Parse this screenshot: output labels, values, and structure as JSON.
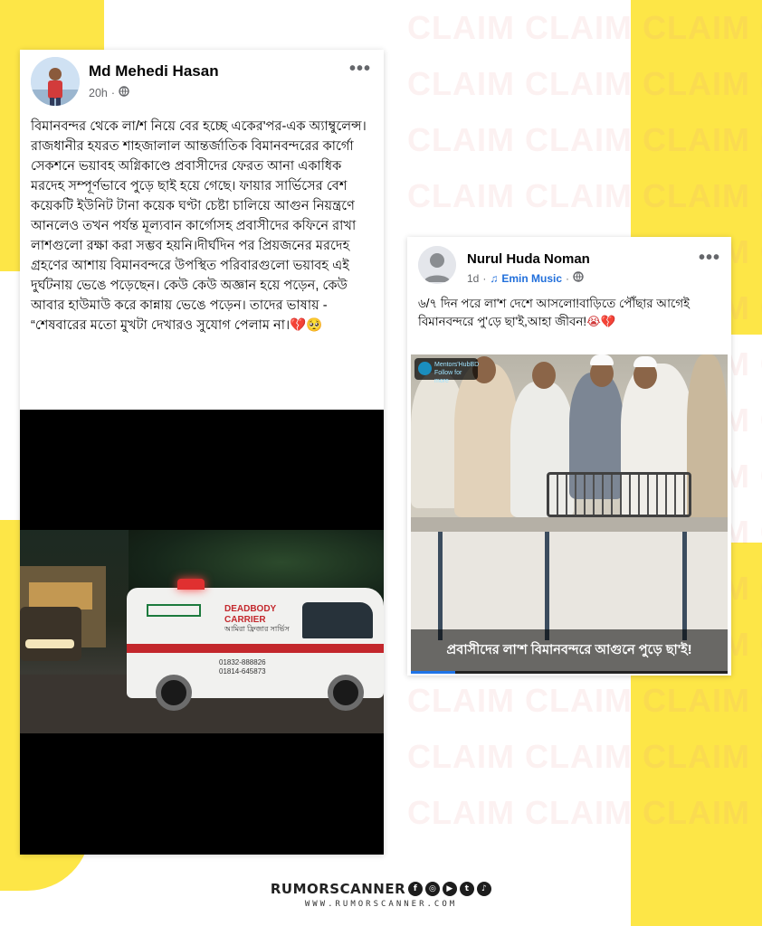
{
  "watermark": {
    "rows": [
      "CLAIM CLAIM CLAIM CLAIM",
      "CLAIM CLAIM CLAIM CLAIM",
      "CLAIM CLAIM CLAIM CLAIM",
      "CLAIM CLAIM CLAIM CLAIM",
      "CLAIM CLAIM CLAIM CLAIM",
      "CLAIM CLAIM CLAIM CLAIM",
      "CLAIM CLAIM CLAIM CLAIM",
      "CLAIM CLAIM CLAIM CLAIM",
      "CLAIM CLAIM CLAIM CLAIM",
      "CLAIM CLAIM CLAIM CLAIM",
      "CLAIM CLAIM CLAIM CLAIM",
      "CLAIM CLAIM CLAIM CLAIM",
      "CLAIM CLAIM CLAIM CLAIM",
      "CLAIM CLAIM CLAIM CLAIM",
      "CLAIM CLAIM CLAIM CLAIM"
    ]
  },
  "post1": {
    "author": "Md Mehedi Hasan",
    "time": "20h",
    "separator": "·",
    "privacy_icon": "globe-icon",
    "more": "•••",
    "text": "বিমানবন্দর থেকে লা/শ নিয়ে বের হচ্ছে একের'পর-এক অ্যাম্বুলেন্স।রাজধানীর হযরত শাহজালাল আন্তর্জাতিক বিমানবন্দরের কার্গো সেকশনে ভয়াবহ অগ্নিকাণ্ডে প্রবাসীদের ফেরত আনা একাধিক মরদেহ সম্পূর্ণভাবে পুড়ে ছাই হয়ে গেছে। ফায়ার সার্ভিসের বেশ কয়েকটি ইউনিট টানা কয়েক ঘণ্টা চেষ্টা চালিয়ে আগুন নিয়ন্ত্রণে আনলেও তখন পর্যন্ত মূল্যবান কার্গোসহ প্রবাসীদের কফিনে রাখা লাশগুলো রক্ষা করা সম্ভব হয়নি।দীর্ঘদিন পর প্রিয়জনের মরদেহ গ্রহণের আশায় বিমানবন্দরে উপস্থিত পরিবারগুলো ভয়াবহ এই দুর্ঘটনায় ভেঙে পড়েছেন। কেউ কেউ অজ্ঞান হয়ে পড়েন, কেউ আবার হাউমাউ করে কান্নায় ভেঙে পড়েন। তাদের ভাষায় - “শেষবারের মতো মুখটা দেখারও সুযোগ পেলাম না।",
    "emoji": "💔🥺",
    "ambulance": {
      "line1": "DEADBODY",
      "line2": "CARRIER",
      "line3": "আমিরা ফ্রিজার সার্ভিস",
      "phone1": "01832-888826",
      "phone2": "01814-645873"
    }
  },
  "post2": {
    "author": "Nurul Huda Noman",
    "time": "1d",
    "separator": "·",
    "music_icon": "music-note-icon",
    "music": "Emin Music",
    "privacy_icon": "globe-icon",
    "more": "•••",
    "text": "৬/৭ দিন পরে লা'শ দেশে আসলো!বাড়িতে পৌঁছার আগেই বিমানবন্দরে পু'ড়ে ছা'ই,আহা জীবন!",
    "emoji": "😭💔",
    "caption": "প্রবাসীদের লা'শ বিমানবন্দরে আগুনে পুড়ে ছা'ই!",
    "chip_line1": "Mentors'HubBD",
    "chip_line2": "Follow for more",
    "video_progress": 0.14
  },
  "footer": {
    "brand": "RUMORSCANNER",
    "url": "WWW.RUMORSCANNER.COM",
    "social_icons": [
      "facebook-icon",
      "instagram-icon",
      "youtube-icon",
      "twitter-icon",
      "tiktok-icon"
    ]
  },
  "colors": {
    "accent_yellow": "#fde647",
    "facebook_blue": "#216fdb"
  }
}
